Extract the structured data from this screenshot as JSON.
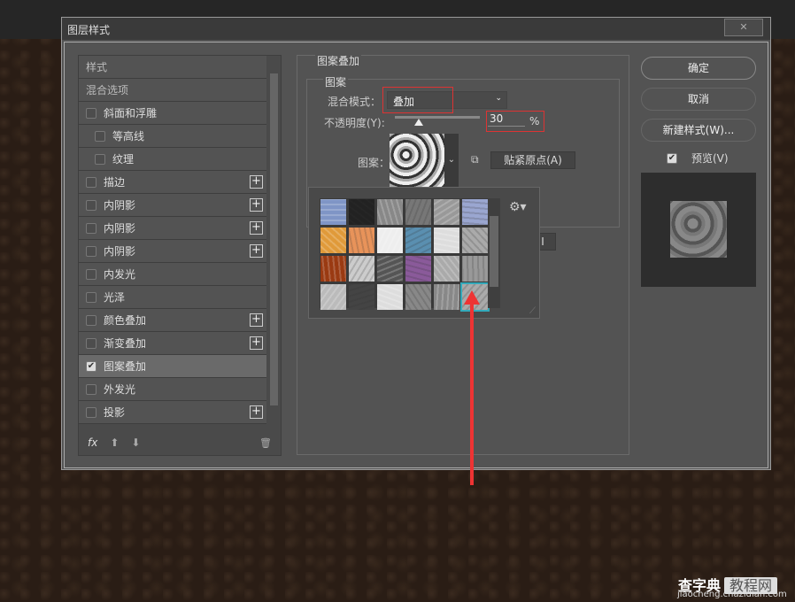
{
  "dialog": {
    "title": "图层样式",
    "close": "✕"
  },
  "styles_list": {
    "items": [
      {
        "label": "样式",
        "type": "header"
      },
      {
        "label": "混合选项",
        "type": "header"
      },
      {
        "label": "斜面和浮雕",
        "checked": false
      },
      {
        "label": "等高线",
        "checked": false,
        "sub": true
      },
      {
        "label": "纹理",
        "checked": false,
        "sub": true
      },
      {
        "label": "描边",
        "checked": false,
        "plus": true
      },
      {
        "label": "内阴影",
        "checked": false,
        "plus": true
      },
      {
        "label": "内阴影",
        "checked": false,
        "plus": true
      },
      {
        "label": "内阴影",
        "checked": false,
        "plus": true
      },
      {
        "label": "内发光",
        "checked": false
      },
      {
        "label": "光泽",
        "checked": false
      },
      {
        "label": "颜色叠加",
        "checked": false,
        "plus": true
      },
      {
        "label": "渐变叠加",
        "checked": false,
        "plus": true
      },
      {
        "label": "图案叠加",
        "checked": true,
        "selected": true
      },
      {
        "label": "外发光",
        "checked": false
      },
      {
        "label": "投影",
        "checked": false,
        "plus": true
      }
    ],
    "footer": {
      "fx": "fx",
      "up": "⬆",
      "down": "⬇",
      "trash": "🗑"
    }
  },
  "pattern_overlay": {
    "group_title": "图案叠加",
    "sub_title": "图案",
    "blend_mode_label": "混合模式：",
    "blend_mode_value": "叠加",
    "opacity_label": "不透明度(Y):",
    "opacity_value": "30",
    "opacity_unit": "%",
    "pattern_label": "图案：",
    "snap_button": "贴紧原点(A)",
    "partial_button": "I",
    "swatches": [
      "#7f95c6",
      "#222",
      "#888",
      "#777",
      "#999",
      "#9aa6d0",
      "#e09a3a",
      "#e8935a",
      "#eee",
      "#5a8fb0",
      "#ddd",
      "#aaa",
      "#9a3a12",
      "#ccc",
      "#555",
      "#8a5a9a",
      "#aaa",
      "#999",
      "#bbb",
      "#444",
      "#ddd",
      "#888",
      "#888",
      "#aaa"
    ],
    "selected_swatch": 23
  },
  "buttons": {
    "ok": "确定",
    "cancel": "取消",
    "new_style": "新建样式(W)...",
    "preview_label": "预览(V)",
    "preview_checked": true
  },
  "watermark": {
    "brand": "查字典",
    "tag": "教程网",
    "url": "jiaocheng.chazidian.com"
  },
  "colors": {
    "accent_red": "#dd3333",
    "dialog_bg": "#535353",
    "selected_swatch": "#33aabb"
  }
}
